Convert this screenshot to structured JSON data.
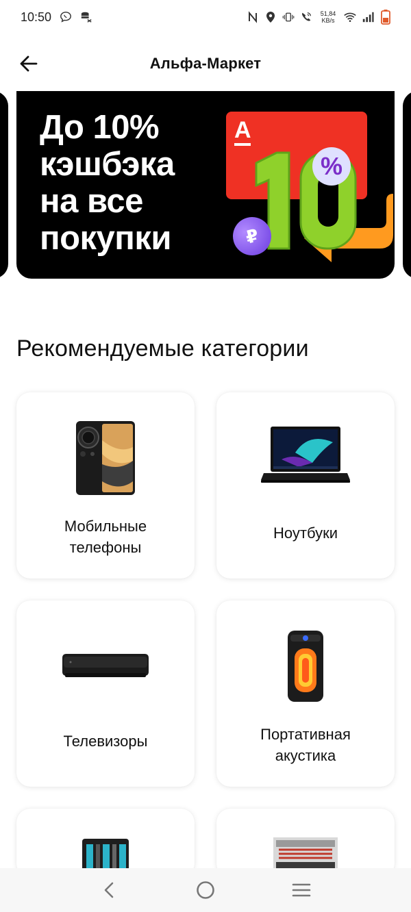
{
  "status_bar": {
    "time": "10:50",
    "net_speed_value": "51,84",
    "net_speed_unit": "KB/s"
  },
  "app_bar": {
    "title": "Альфа-Маркет"
  },
  "banner": {
    "headline_lines": [
      "До 10%",
      "кэшбэка",
      "на все",
      "покупки"
    ],
    "card_logo": "А",
    "big_number": "10",
    "percent": "%",
    "coin_symbol": "₽"
  },
  "section": {
    "title": "Рекомендуемые категории"
  },
  "categories": [
    {
      "label_line1": "Мобильные",
      "label_line2": "телефоны",
      "icon": "phone-image"
    },
    {
      "label_line1": "Ноутбуки",
      "label_line2": "",
      "icon": "laptop-image"
    },
    {
      "label_line1": "Телевизоры",
      "label_line2": "",
      "icon": "projector-image"
    },
    {
      "label_line1": "Портативная",
      "label_line2": "акустика",
      "icon": "speaker-image"
    }
  ],
  "colors": {
    "accent_red": "#ef3124",
    "banner_bg": "#000000",
    "ten_green": "#8fd12b",
    "arrow_orange": "#ff9a1f"
  }
}
